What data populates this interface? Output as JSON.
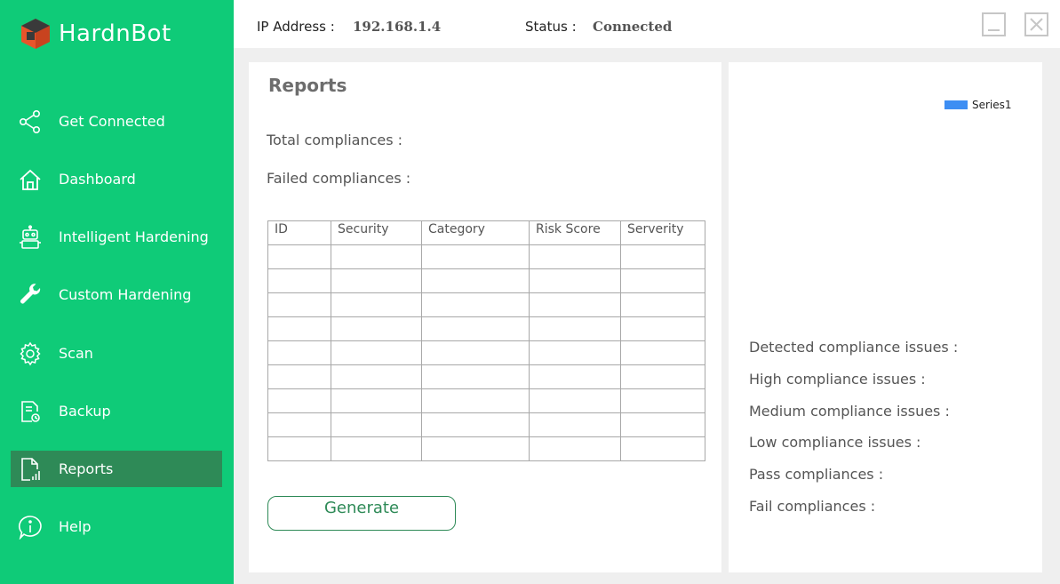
{
  "app": {
    "name": "HardnBot"
  },
  "sidebar": {
    "items": [
      {
        "label": "Get Connected",
        "icon": "share-icon"
      },
      {
        "label": "Dashboard",
        "icon": "home-icon"
      },
      {
        "label": "Intelligent Hardening",
        "icon": "robot-icon"
      },
      {
        "label": "Custom Hardening",
        "icon": "wrench-icon"
      },
      {
        "label": "Scan",
        "icon": "gear-icon"
      },
      {
        "label": "Backup",
        "icon": "backup-document-icon"
      },
      {
        "label": "Reports",
        "icon": "report-document-icon",
        "active": true
      },
      {
        "label": "Help",
        "icon": "info-icon"
      }
    ]
  },
  "topbar": {
    "ip_label": "IP Address :",
    "ip_value": "192.168.1.4",
    "status_label": "Status :",
    "status_value": "Connected"
  },
  "reports": {
    "title": "Reports",
    "total_label": "Total compliances :",
    "failed_label": "Failed compliances :",
    "table": {
      "columns": [
        "ID",
        "Security",
        "Category",
        "Risk Score",
        "Serverity"
      ],
      "rows": [
        [
          "",
          "",
          "",
          "",
          ""
        ],
        [
          "",
          "",
          "",
          "",
          ""
        ],
        [
          "",
          "",
          "",
          "",
          ""
        ],
        [
          "",
          "",
          "",
          "",
          ""
        ],
        [
          "",
          "",
          "",
          "",
          ""
        ],
        [
          "",
          "",
          "",
          "",
          ""
        ],
        [
          "",
          "",
          "",
          "",
          ""
        ],
        [
          "",
          "",
          "",
          "",
          ""
        ],
        [
          "",
          "",
          "",
          "",
          ""
        ]
      ]
    },
    "generate_label": "Generate"
  },
  "summary": {
    "legend_series": "Series1",
    "detected_label": "Detected compliance issues :",
    "high_label": "High compliance issues :",
    "medium_label": "Medium compliance issues :",
    "low_label": "Low compliance issues :",
    "pass_label": "Pass compliances :",
    "fail_label": "Fail compliances :"
  },
  "colors": {
    "sidebar_bg": "#0fcb78",
    "sidebar_active": "#2e8a57",
    "legend_series": "#3d8ef3"
  }
}
